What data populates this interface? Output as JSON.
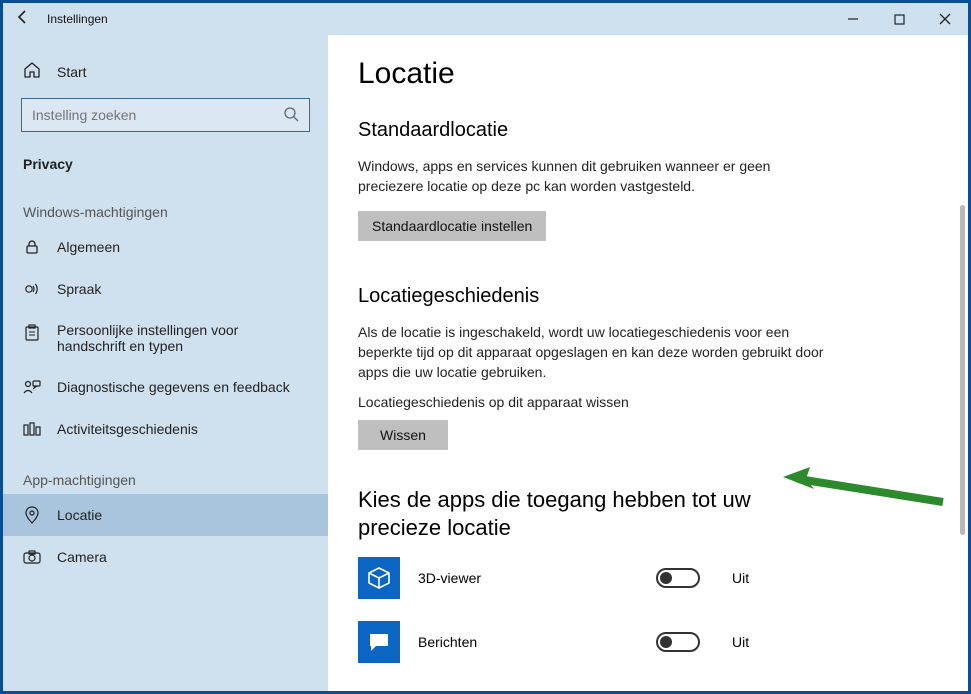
{
  "titlebar": {
    "title": "Instellingen"
  },
  "sidebar": {
    "home_label": "Start",
    "search_placeholder": "Instelling zoeken",
    "category_label": "Privacy",
    "section1_label": "Windows-machtigingen",
    "section2_label": "App-machtigingen",
    "items": [
      {
        "label": "Algemeen"
      },
      {
        "label": "Spraak"
      },
      {
        "label": "Persoonlijke instellingen voor handschrift en typen"
      },
      {
        "label": "Diagnostische gegevens en feedback"
      },
      {
        "label": "Activiteitsgeschiedenis"
      }
    ],
    "app_items": [
      {
        "label": "Locatie",
        "active": true
      },
      {
        "label": "Camera"
      }
    ]
  },
  "content": {
    "page_title": "Locatie",
    "section1": {
      "heading": "Standaardlocatie",
      "desc": "Windows, apps en services kunnen dit gebruiken wanneer er geen preciezere locatie op deze pc kan worden vastgesteld.",
      "button": "Standaardlocatie instellen"
    },
    "section2": {
      "heading": "Locatiegeschiedenis",
      "desc": "Als de locatie is ingeschakeld, wordt uw locatiegeschiedenis voor een beperkte tijd op dit apparaat opgeslagen en kan deze worden gebruikt door apps die uw locatie gebruiken.",
      "clear_label": "Locatiegeschiedenis op dit apparaat wissen",
      "clear_button": "Wissen"
    },
    "section3": {
      "heading": "Kies de apps die toegang hebben tot uw precieze locatie",
      "apps": [
        {
          "name": "3D-viewer",
          "state": "Uit"
        },
        {
          "name": "Berichten",
          "state": "Uit"
        }
      ]
    }
  }
}
